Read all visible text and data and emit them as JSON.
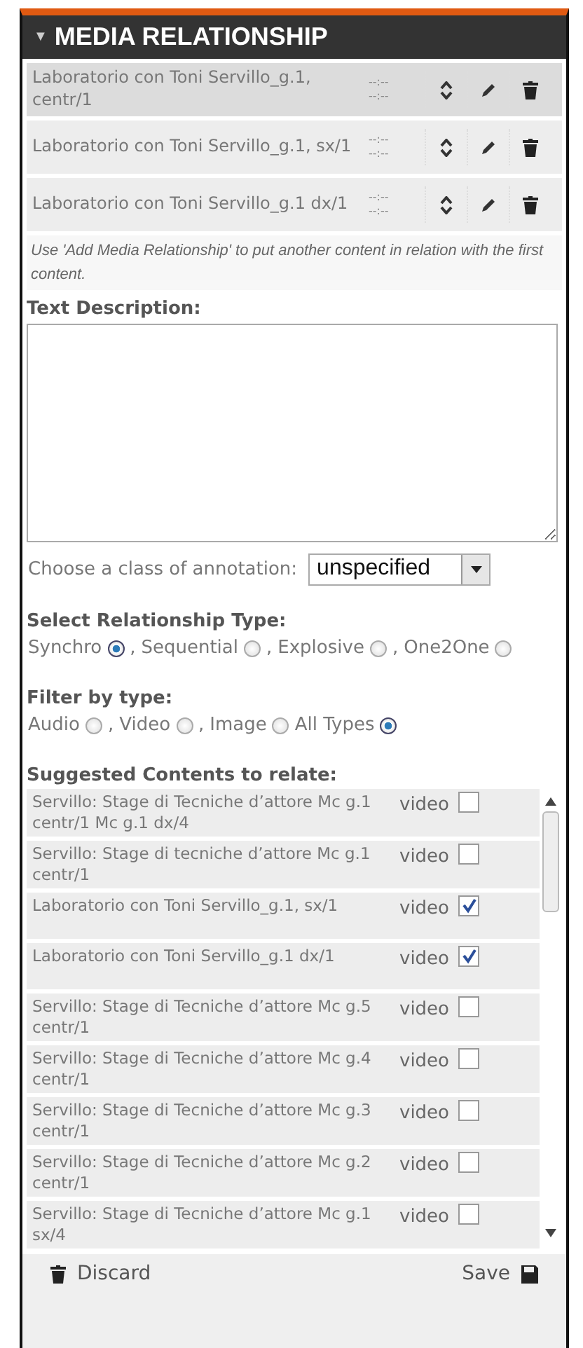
{
  "panel": {
    "title": "MEDIA RELATIONSHIP",
    "toggle": "▼",
    "expanded": true
  },
  "relations": [
    {
      "title": "Laboratorio con Toni Servillo_g.1, centr/1",
      "time_start": "--:--",
      "time_end": "--:--",
      "selected": true
    },
    {
      "title": "Laboratorio con Toni Servillo_g.1, sx/1",
      "time_start": "--:--",
      "time_end": "--:--",
      "selected": false
    },
    {
      "title": "Laboratorio con Toni Servillo_g.1 dx/1",
      "time_start": "--:--",
      "time_end": "--:--",
      "selected": false
    }
  ],
  "hint": "Use 'Add Media Relationship' to put another content in relation with the first content.",
  "description": {
    "label": "Text Description:"
  },
  "annotation": {
    "label": "Choose a class of annotation:",
    "value": "unspecified"
  },
  "relationship_type": {
    "label": "Select Relationship Type:",
    "options": [
      {
        "label": "Synchro",
        "selected": true,
        "separator": ","
      },
      {
        "label": "Sequential",
        "selected": false,
        "separator": ","
      },
      {
        "label": "Explosive",
        "selected": false,
        "separator": ","
      },
      {
        "label": "One2One",
        "selected": false
      }
    ]
  },
  "filter": {
    "label": "Filter by type:",
    "options": [
      {
        "label": "Audio",
        "selected": false,
        "separator": ","
      },
      {
        "label": "Video",
        "selected": false,
        "separator": ","
      },
      {
        "label": "Image",
        "selected": false
      },
      {
        "label": "All Types",
        "selected": true
      }
    ]
  },
  "suggestions": {
    "label": "Suggested Contents to relate:",
    "items": [
      {
        "title": "Servillo: Stage di Tecniche d’attore Mc g.1 centr/1 Mc g.1 dx/4",
        "type": "video",
        "checked": false
      },
      {
        "title": "Servillo: Stage di tecniche d’attore Mc g.1 centr/1",
        "type": "video",
        "checked": false
      },
      {
        "title": "Laboratorio con Toni Servillo_g.1, sx/1",
        "type": "video",
        "checked": true
      },
      {
        "title": "Laboratorio con Toni Servillo_g.1 dx/1",
        "type": "video",
        "checked": true
      },
      {
        "title": "Servillo: Stage di Tecniche d’attore Mc g.5 centr/1",
        "type": "video",
        "checked": false
      },
      {
        "title": "Servillo: Stage di Tecniche d’attore Mc g.4 centr/1",
        "type": "video",
        "checked": false
      },
      {
        "title": "Servillo: Stage di Tecniche d’attore Mc g.3 centr/1",
        "type": "video",
        "checked": false
      },
      {
        "title": "Servillo: Stage di Tecniche d’attore Mc g.2 centr/1",
        "type": "video",
        "checked": false
      },
      {
        "title": "Servillo: Stage di Tecniche d’attore Mc g.1 sx/4",
        "type": "video",
        "checked": false
      }
    ]
  },
  "footer": {
    "discard": "Discard",
    "save": "Save"
  }
}
